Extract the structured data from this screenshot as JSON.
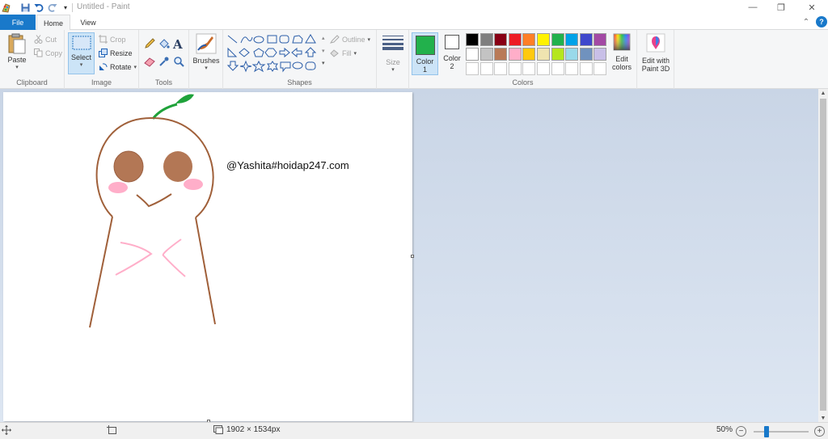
{
  "window": {
    "title": "Untitled - Paint",
    "minimize": "—",
    "restore": "❐",
    "close": "✕"
  },
  "tabs": {
    "file": "File",
    "home": "Home",
    "view": "View"
  },
  "ribbon": {
    "clipboard": {
      "label": "Clipboard",
      "paste": "Paste",
      "cut": "Cut",
      "copy": "Copy"
    },
    "image": {
      "label": "Image",
      "select": "Select",
      "crop": "Crop",
      "resize": "Resize",
      "rotate": "Rotate"
    },
    "tools": {
      "label": "Tools"
    },
    "brushes": {
      "label": "Brushes"
    },
    "shapes": {
      "label": "Shapes",
      "outline": "Outline",
      "fill": "Fill"
    },
    "size": {
      "label": "Size"
    },
    "colors": {
      "label": "Colors",
      "color1_line1": "Color",
      "color1_line2": "1",
      "color2_line1": "Color",
      "color2_line2": "2",
      "edit_line1": "Edit",
      "edit_line2": "colors",
      "color1_value": "#22b14c",
      "color2_value": "#ffffff",
      "palette_row1": [
        "#000000",
        "#7f7f7f",
        "#880015",
        "#ed1c24",
        "#ff7f27",
        "#fff200",
        "#22b14c",
        "#00a2e8",
        "#3f48cc",
        "#a349a4"
      ],
      "palette_row2": [
        "#ffffff",
        "#c3c3c3",
        "#b97a57",
        "#ffaec9",
        "#ffc90e",
        "#efe4b0",
        "#b5e61d",
        "#99d9ea",
        "#7092be",
        "#c8bfe7"
      ],
      "palette_row3": [
        "#ffffff",
        "#ffffff",
        "#ffffff",
        "#ffffff",
        "#ffffff",
        "#ffffff",
        "#ffffff",
        "#ffffff",
        "#ffffff",
        "#ffffff"
      ]
    },
    "paint3d": {
      "line1": "Edit with",
      "line2": "Paint 3D"
    }
  },
  "canvas": {
    "watermark_text": "@Yashita#hoidap247.com",
    "stroke_brown": "#a0603a",
    "stem_green": "#1fa23a",
    "cheek_pink": "#ffaec9",
    "eye_brown": "#b37755"
  },
  "status": {
    "dimensions": "1902 × 1534px",
    "zoom": "50%"
  }
}
